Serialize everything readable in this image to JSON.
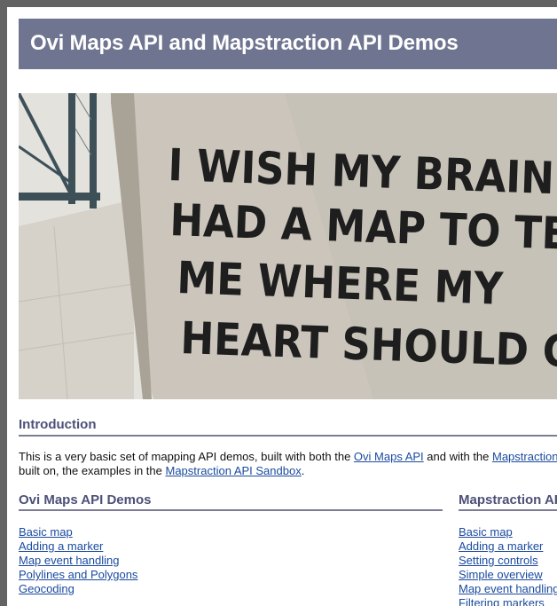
{
  "header": {
    "title": "Ovi Maps API and Mapstraction API Demos"
  },
  "hero": {
    "lines": [
      "I WISH MY BRAIN",
      "HAD A MAP TO TELL",
      "ME WHERE MY",
      "HEART SHOULD GO"
    ]
  },
  "intro": {
    "title": "Introduction",
    "text_before_ovi": "This is a very basic set of mapping API demos, built with both the ",
    "ovi_link": "Ovi Maps API",
    "text_between": " and with the ",
    "mapstraction_link": "Mapstraction",
    "line2_start": "built on, the examples in the ",
    "sandbox_link": "Mapstraction API Sandbox",
    "line2_end": "."
  },
  "ovi_demos": {
    "title": "Ovi Maps API Demos",
    "links": [
      "Basic map",
      "Adding a marker",
      "Map event handling",
      "Polylines and Polygons",
      "Geocoding"
    ]
  },
  "mapstraction_demos": {
    "title": "Mapstraction API Demos",
    "links": [
      "Basic map",
      "Adding a marker",
      "Setting controls",
      "Simple overview",
      "Map event handling",
      "Filtering markers"
    ]
  },
  "colors": {
    "header_bg": "#6f7590",
    "section_title": "#4d5078",
    "link": "#1a4a9e",
    "frame": "#636363"
  }
}
